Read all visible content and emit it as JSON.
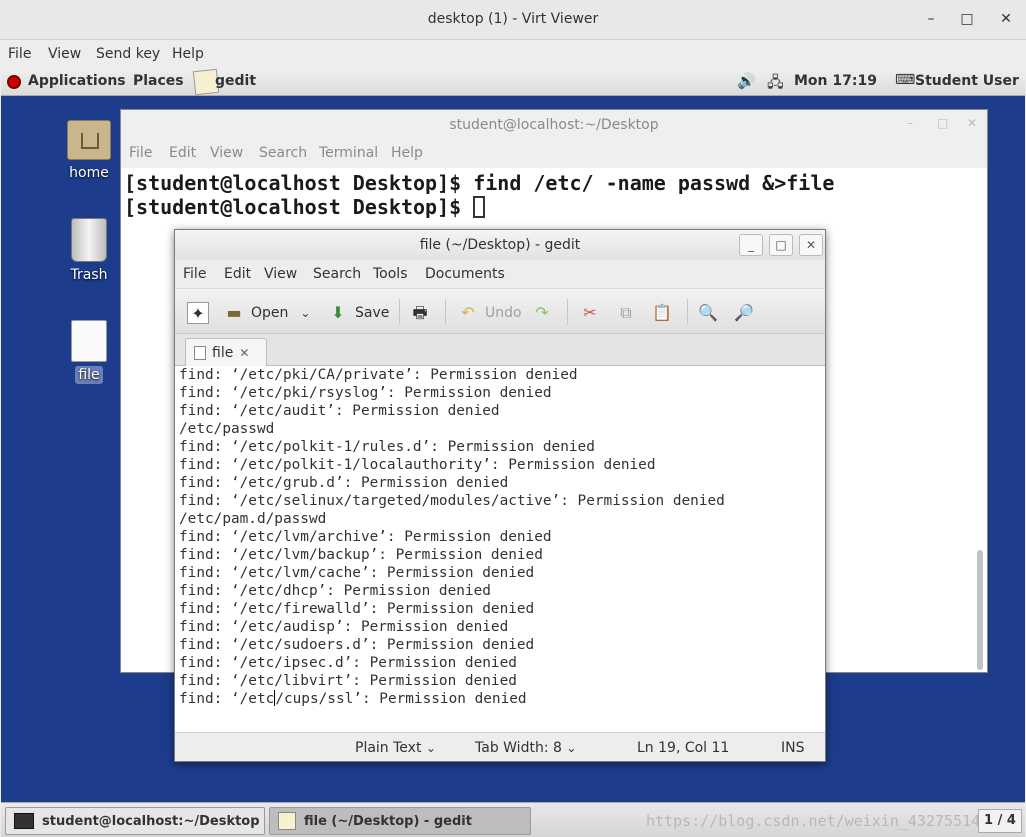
{
  "window": {
    "title": "desktop (1) - Virt Viewer",
    "minimize": "–",
    "maximize": "□",
    "close": "✕"
  },
  "viewer_menu": [
    "File",
    "View",
    "Send key",
    "Help"
  ],
  "topbar": {
    "applications": "Applications",
    "places": "Places",
    "app": "gedit",
    "clock": "Mon 17:19",
    "user": "Student User"
  },
  "desktop_icons": {
    "home": "home",
    "trash": "Trash",
    "file": "file"
  },
  "terminal": {
    "title": "student@localhost:~/Desktop",
    "menu": [
      "File",
      "Edit",
      "View",
      "Search",
      "Terminal",
      "Help"
    ],
    "lines": [
      "[student@localhost Desktop]$ find /etc/ -name passwd &>file",
      "[student@localhost Desktop]$ "
    ]
  },
  "gedit": {
    "title": "file (~/Desktop) - gedit",
    "menu": [
      "File",
      "Edit",
      "View",
      "Search",
      "Tools",
      "Documents"
    ],
    "toolbar": {
      "open": "Open",
      "save": "Save",
      "undo": "Undo"
    },
    "tab": "file",
    "lines": [
      "find: ‘/etc/pki/CA/private’: Permission denied",
      "find: ‘/etc/pki/rsyslog’: Permission denied",
      "find: ‘/etc/audit’: Permission denied",
      "/etc/passwd",
      "find: ‘/etc/polkit-1/rules.d’: Permission denied",
      "find: ‘/etc/polkit-1/localauthority’: Permission denied",
      "find: ‘/etc/grub.d’: Permission denied",
      "find: ‘/etc/selinux/targeted/modules/active’: Permission denied",
      "/etc/pam.d/passwd",
      "find: ‘/etc/lvm/archive’: Permission denied",
      "find: ‘/etc/lvm/backup’: Permission denied",
      "find: ‘/etc/lvm/cache’: Permission denied",
      "find: ‘/etc/dhcp’: Permission denied",
      "find: ‘/etc/firewalld’: Permission denied",
      "find: ‘/etc/audisp’: Permission denied",
      "find: ‘/etc/sudoers.d’: Permission denied",
      "find: ‘/etc/ipsec.d’: Permission denied",
      "find: ‘/etc/libvirt’: Permission denied"
    ],
    "last_line_before_caret": "find: ‘/etc",
    "last_line_after_caret": "/cups/ssl’: Permission denied",
    "status": {
      "language": "Plain Text",
      "tab_width": "Tab Width:  8",
      "position": "Ln 19, Col 11",
      "mode": "INS"
    }
  },
  "taskbar": {
    "terminal": "student@localhost:~/Desktop",
    "gedit": "file (~/Desktop) - gedit",
    "watermark": "https://blog.csdn.net/weixin_43275514",
    "pager": "1 / 4"
  }
}
